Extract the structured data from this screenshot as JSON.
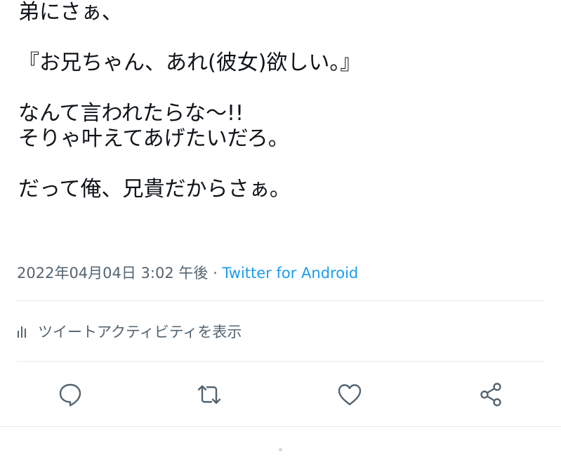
{
  "tweet": {
    "lines": [
      "弟にさぁ、",
      "",
      "『お兄ちゃん、あれ(彼女)欲しい。』",
      "",
      "なんて言われたらな〜!!",
      "そりゃ叶えてあげたいだろ。",
      "",
      "だって俺、兄貴だからさぁ。"
    ],
    "timestamp": "2022年04月04日 3:02 午後",
    "separator": " · ",
    "source": "Twitter for Android"
  },
  "activity": {
    "label": "ツイートアクティビティを表示",
    "icon": "bar-chart-icon"
  },
  "actions": {
    "reply_icon": "reply-icon",
    "retweet_icon": "retweet-icon",
    "like_icon": "heart-icon",
    "share_icon": "share-icon"
  },
  "colors": {
    "text": "#0f1419",
    "secondary": "#536471",
    "accent": "#1d9bf0",
    "divider": "#e1e8ed"
  }
}
